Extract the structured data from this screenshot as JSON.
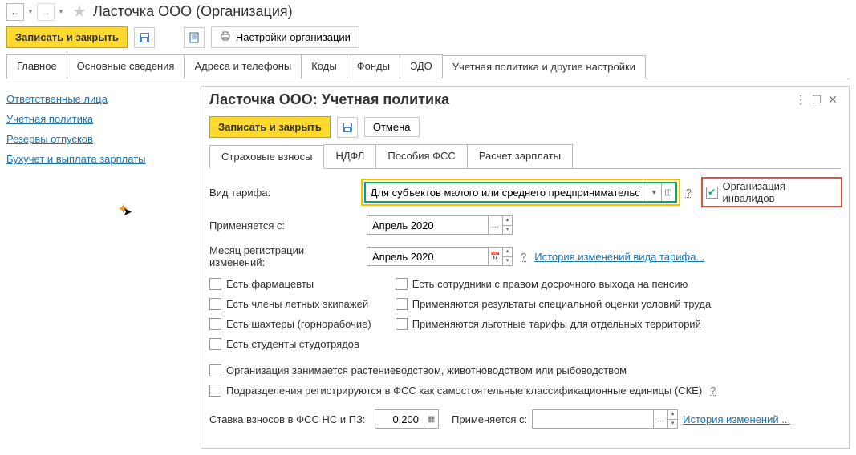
{
  "window": {
    "title": "Ласточка ООО (Организация)"
  },
  "toolbar": {
    "save_close": "Записать и закрыть",
    "settings_org": "Настройки организации"
  },
  "tabs": {
    "items": [
      {
        "label": "Главное"
      },
      {
        "label": "Основные сведения"
      },
      {
        "label": "Адреса и телефоны"
      },
      {
        "label": "Коды"
      },
      {
        "label": "Фонды"
      },
      {
        "label": "ЭДО"
      },
      {
        "label": "Учетная политика и другие настройки"
      }
    ]
  },
  "sidebar": {
    "items": [
      {
        "label": "Ответственные лица"
      },
      {
        "label": "Учетная политика"
      },
      {
        "label": "Резервы отпусков"
      },
      {
        "label": "Бухучет и выплата зарплаты"
      }
    ]
  },
  "inner": {
    "title": "Ласточка ООО: Учетная политика",
    "save_close": "Записать и закрыть",
    "cancel": "Отмена",
    "tabs": [
      {
        "label": "Страховые взносы"
      },
      {
        "label": "НДФЛ"
      },
      {
        "label": "Пособия ФСС"
      },
      {
        "label": "Расчет зарплаты"
      }
    ],
    "tariff_label": "Вид тарифа:",
    "tariff_value": "Для субъектов малого или среднего предпринимательс",
    "org_inv": "Организация инвалидов",
    "applies_from_label": "Применяется с:",
    "applies_from_value": "Апрель 2020",
    "month_reg_label": "Месяц регистрации изменений:",
    "month_reg_value": "Апрель 2020",
    "history_link": "История изменений вида тарифа...",
    "checks_left": [
      "Есть фармацевты",
      "Есть члены летных экипажей",
      "Есть шахтеры (горнорабочие)",
      "Есть студенты студотрядов"
    ],
    "checks_right": [
      "Есть сотрудники с правом досрочного выхода на пенсию",
      "Применяются результаты специальной оценки условий труда",
      "Применяются льготные тарифы для отдельных территорий"
    ],
    "check_agro": "Организация занимается растениеводством, животноводством или рыбоводством",
    "check_fss": "Подразделения регистрируются в ФСС как самостоятельные классификационные единицы (СКЕ)",
    "rate_label": "Ставка взносов в ФСС НС и ПЗ:",
    "rate_value": "0,200",
    "rate_applies_label": "Применяется с:",
    "rate_history": "История изменений ..."
  }
}
